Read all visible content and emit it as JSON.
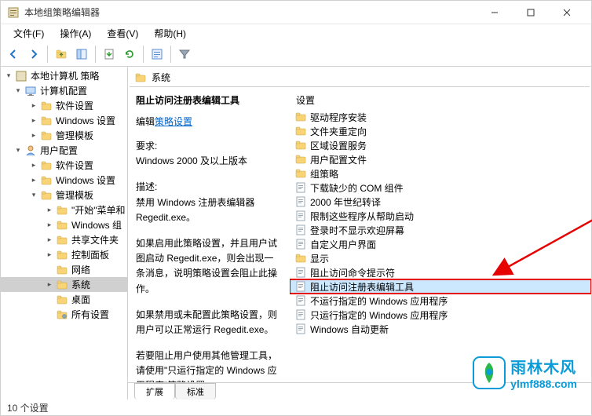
{
  "window": {
    "title": "本地组策略编辑器"
  },
  "menubar": [
    "文件(F)",
    "操作(A)",
    "查看(V)",
    "帮助(H)"
  ],
  "tree": {
    "root": {
      "label": "本地计算机 策略"
    },
    "computer": {
      "label": "计算机配置",
      "children": [
        "软件设置",
        "Windows 设置",
        "管理模板"
      ]
    },
    "user": {
      "label": "用户配置",
      "children": {
        "soft": "软件设置",
        "win": "Windows 设置",
        "admin": {
          "label": "管理模板",
          "children": [
            "\"开始\"菜单和",
            "Windows 组",
            "共享文件夹",
            "控制面板",
            "网络",
            "系统",
            "桌面",
            "所有设置"
          ]
        }
      }
    }
  },
  "breadcrumb": "系统",
  "policy": {
    "title": "阻止访问注册表编辑工具",
    "edit_label": "编辑",
    "edit_link": "策略设置",
    "req_label": "要求:",
    "req_value": "Windows 2000 及以上版本",
    "desc_label": "描述:",
    "desc_p1": "禁用 Windows 注册表编辑器 Regedit.exe。",
    "desc_p2": "如果启用此策略设置，并且用户试图启动 Regedit.exe，则会出现一条消息，说明策略设置会阻止此操作。",
    "desc_p3": "如果禁用或未配置此策略设置，则用户可以正常运行 Regedit.exe。",
    "desc_p4": "若要阻止用户使用其他管理工具，请使用\"只运行指定的 Windows 应用程序\"策略设置。"
  },
  "settings": {
    "header": "设置",
    "items": [
      {
        "label": "驱动程序安装",
        "type": "folder"
      },
      {
        "label": "文件夹重定向",
        "type": "folder"
      },
      {
        "label": "区域设置服务",
        "type": "folder"
      },
      {
        "label": "用户配置文件",
        "type": "folder"
      },
      {
        "label": "组策略",
        "type": "folder"
      },
      {
        "label": "下载缺少的 COM 组件",
        "type": "policy"
      },
      {
        "label": "2000 年世纪转译",
        "type": "policy"
      },
      {
        "label": "限制这些程序从帮助启动",
        "type": "policy"
      },
      {
        "label": "登录时不显示欢迎屏幕",
        "type": "policy"
      },
      {
        "label": "自定义用户界面",
        "type": "policy"
      },
      {
        "label": "显示",
        "type": "folder"
      },
      {
        "label": "阻止访问命令提示符",
        "type": "policy"
      },
      {
        "label": "阻止访问注册表编辑工具",
        "type": "policy",
        "hl": true
      },
      {
        "label": "不运行指定的 Windows 应用程序",
        "type": "policy"
      },
      {
        "label": "只运行指定的 Windows 应用程序",
        "type": "policy"
      },
      {
        "label": "Windows 自动更新",
        "type": "policy"
      }
    ]
  },
  "tabs": [
    "扩展",
    "标准"
  ],
  "statusbar": "10 个设置",
  "watermark": {
    "cn": "雨林木风",
    "url": "ylmf888.com"
  }
}
